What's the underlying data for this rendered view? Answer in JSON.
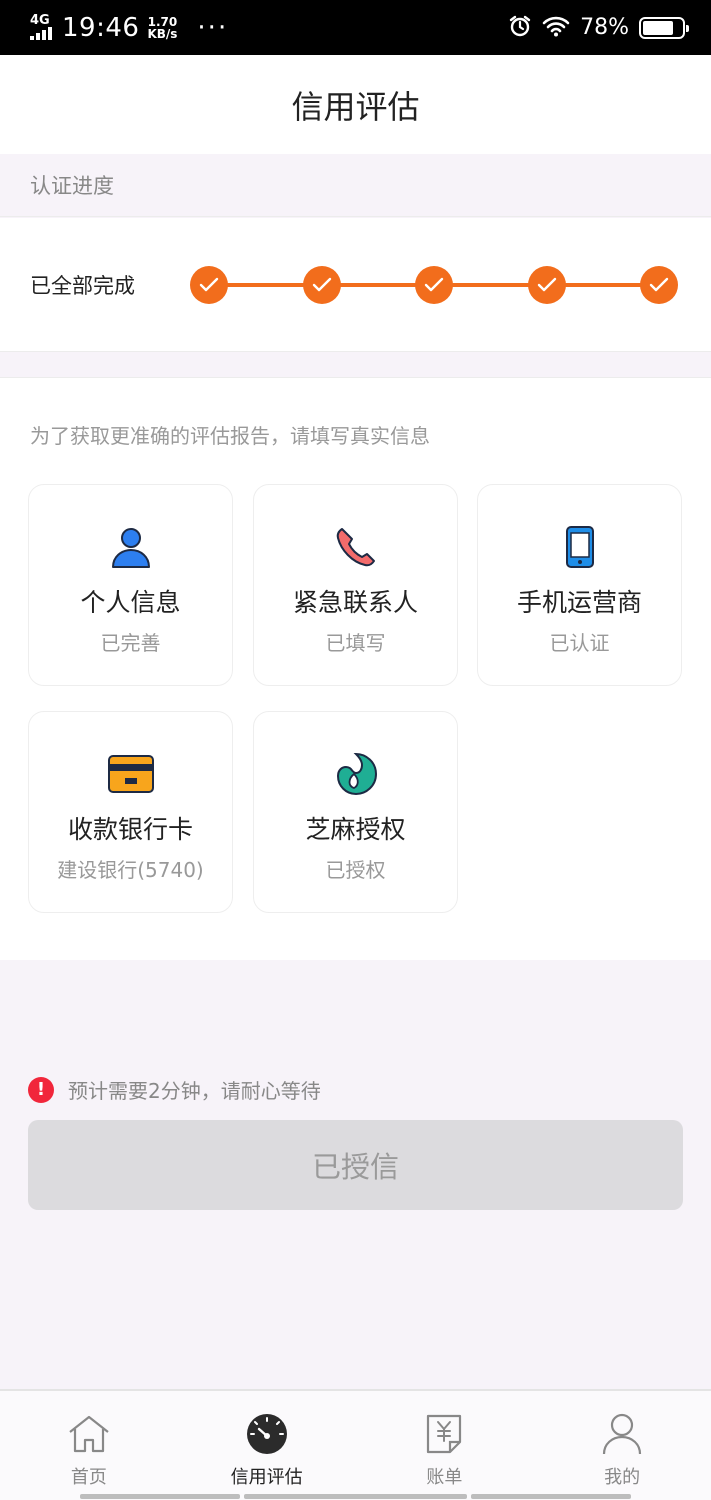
{
  "status_bar": {
    "network": "4G",
    "time": "19:46",
    "speed_value": "1.70",
    "speed_unit": "KB/s",
    "battery_percent": "78%",
    "battery_level": 0.78
  },
  "header": {
    "title": "信用评估"
  },
  "progress": {
    "section_title": "认证进度",
    "status_label": "已全部完成",
    "steps_total": 5,
    "steps_completed": 5,
    "accent_color": "#f26d1c"
  },
  "info": {
    "hint": "为了获取更准确的评估报告，请填写真实信息",
    "tiles": [
      {
        "title": "个人信息",
        "status": "已完善",
        "icon": "person-icon"
      },
      {
        "title": "紧急联系人",
        "status": "已填写",
        "icon": "phone-icon"
      },
      {
        "title": "手机运营商",
        "status": "已认证",
        "icon": "mobile-icon"
      },
      {
        "title": "收款银行卡",
        "status": "建设银行(5740)",
        "icon": "bank-card-icon"
      },
      {
        "title": "芝麻授权",
        "status": "已授权",
        "icon": "sesame-icon"
      }
    ]
  },
  "notice": {
    "text": "预计需要2分钟，请耐心等待"
  },
  "action": {
    "button_label": "已授信"
  },
  "tabbar": {
    "items": [
      {
        "label": "首页",
        "icon": "home-icon",
        "active": false
      },
      {
        "label": "信用评估",
        "icon": "gauge-icon",
        "active": true
      },
      {
        "label": "账单",
        "icon": "bill-icon",
        "active": false
      },
      {
        "label": "我的",
        "icon": "user-icon",
        "active": false
      }
    ]
  }
}
